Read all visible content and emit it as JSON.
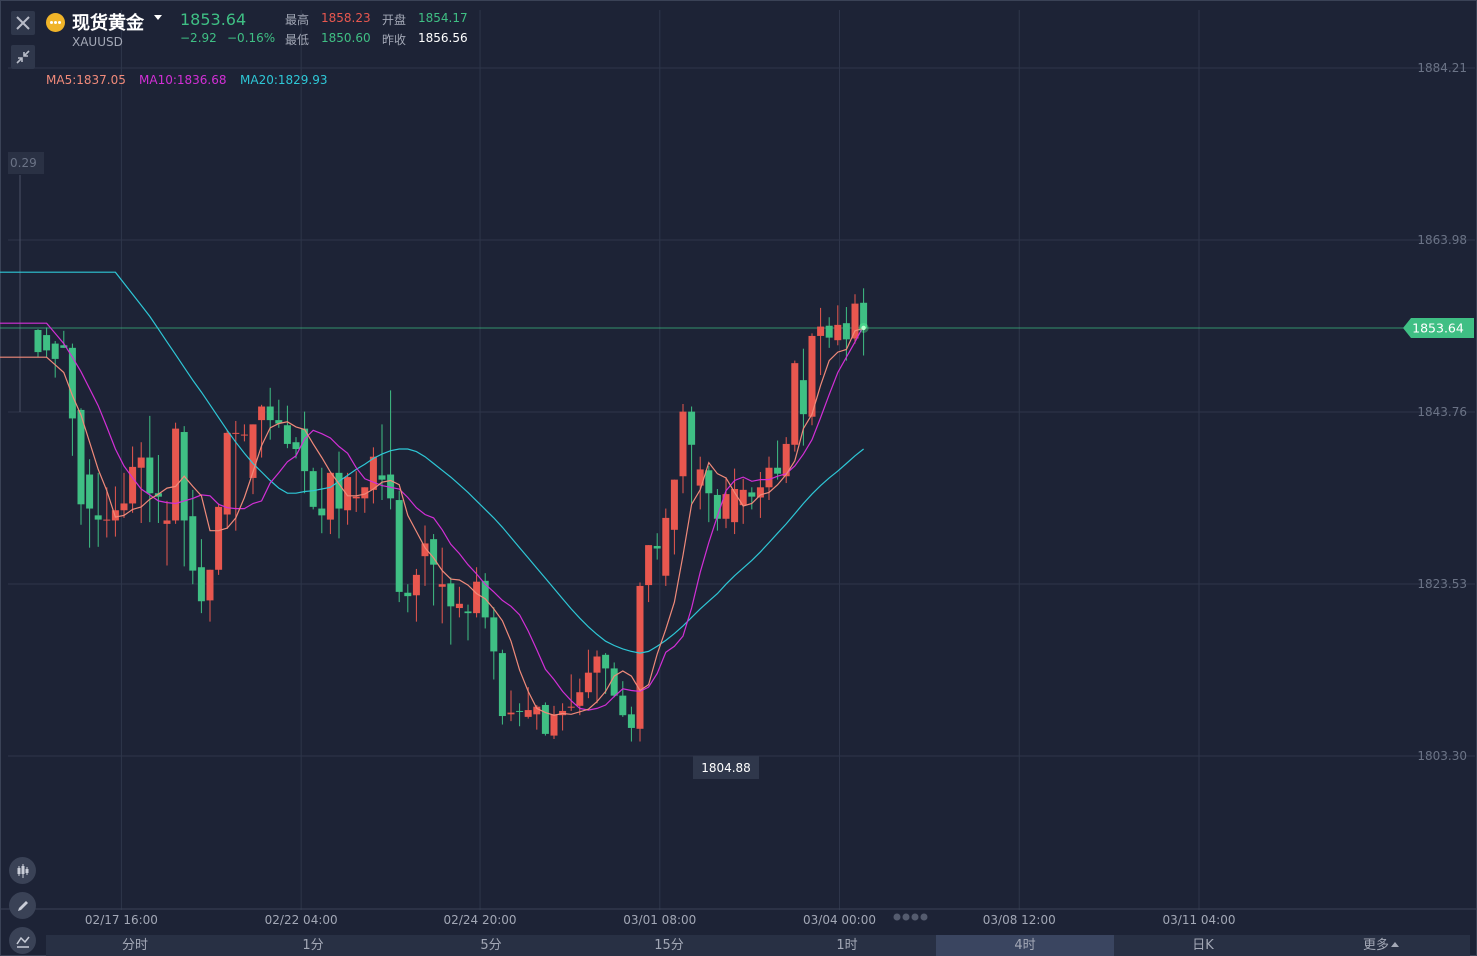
{
  "header": {
    "instrument_name": "现货黄金",
    "symbol": "XAUUSD",
    "last_price": "1853.64",
    "change": "−2.92",
    "change_pct": "−0.16%",
    "high_label": "最高",
    "high_value": "1858.23",
    "low_label": "最低",
    "low_value": "1850.60",
    "open_label": "开盘",
    "open_value": "1854.17",
    "prev_close_label": "昨收",
    "prev_close_value": "1856.56"
  },
  "indicators": {
    "ma5": "MA5:1837.05",
    "ma10": "MA10:1836.68",
    "ma20": "MA20:1829.93"
  },
  "left_fragment_label": "0.29",
  "tabs": [
    "分时",
    "1分",
    "5分",
    "15分",
    "1时",
    "4时",
    "日K",
    "更多"
  ],
  "active_tab": "4时",
  "colors": {
    "background": "#1d2336",
    "up": "#e8574f",
    "down": "#3fbf84",
    "ma5": "#f08a7a",
    "ma10": "#d22fd6",
    "ma20": "#2ec7d6",
    "price_line": "#3fbf84"
  },
  "chart_data": {
    "type": "candlestick",
    "y_ticks": [
      "1884.21",
      "1863.98",
      "1843.76",
      "1823.53",
      "1803.30"
    ],
    "ylim": [
      1796.2,
      1889.8
    ],
    "x_ticks": [
      {
        "label": "02/17 16:00",
        "index": 9.7
      },
      {
        "label": "02/22 04:00",
        "index": 30.6
      },
      {
        "label": "02/24 20:00",
        "index": 51.4
      },
      {
        "label": "03/01 08:00",
        "index": 72.3
      },
      {
        "label": "03/04 00:00",
        "index": 93.2
      },
      {
        "label": "03/08 12:00",
        "index": 114.1
      },
      {
        "label": "03/11 04:00",
        "index": 135.0
      }
    ],
    "current_price": "1853.64",
    "low_annotation": {
      "value": "1804.88",
      "index": 80
    },
    "ohlc": [
      [
        1853.4,
        1853.5,
        1850.2,
        1850.8
      ],
      [
        1852.8,
        1853.7,
        1850.2,
        1851.0
      ],
      [
        1851.8,
        1852.1,
        1847.8,
        1850.0
      ],
      [
        1851.6,
        1853.3,
        1851.3,
        1851.3
      ],
      [
        1851.3,
        1851.8,
        1838.6,
        1843.0
      ],
      [
        1844.0,
        1844.2,
        1830.5,
        1832.9
      ],
      [
        1836.4,
        1838.2,
        1827.8,
        1832.4
      ],
      [
        1831.6,
        1836.6,
        1827.9,
        1831.1
      ],
      [
        1831.0,
        1834.9,
        1829.0,
        1831.1
      ],
      [
        1831.0,
        1835.0,
        1829.1,
        1832.2
      ],
      [
        1832.2,
        1836.6,
        1831.3,
        1833.0
      ],
      [
        1833.0,
        1839.7,
        1831.9,
        1837.3
      ],
      [
        1837.2,
        1840.2,
        1830.7,
        1838.4
      ],
      [
        1838.4,
        1843.3,
        1830.8,
        1834.2
      ],
      [
        1834.2,
        1838.7,
        1830.7,
        1833.8
      ],
      [
        1830.6,
        1833.3,
        1825.7,
        1831.0
      ],
      [
        1831.0,
        1842.5,
        1830.6,
        1841.8
      ],
      [
        1841.4,
        1842.1,
        1825.6,
        1831.0
      ],
      [
        1831.5,
        1834.6,
        1823.5,
        1825.1
      ],
      [
        1825.5,
        1828.8,
        1820.1,
        1821.5
      ],
      [
        1821.6,
        1825.2,
        1819.1,
        1825.2
      ],
      [
        1825.2,
        1833.0,
        1824.6,
        1832.6
      ],
      [
        1831.7,
        1841.6,
        1830.0,
        1841.3
      ],
      [
        1841.2,
        1842.7,
        1829.8,
        1841.3
      ],
      [
        1841.1,
        1842.3,
        1840.3,
        1841.1
      ],
      [
        1836.0,
        1842.3,
        1834.1,
        1842.3
      ],
      [
        1842.8,
        1844.6,
        1838.4,
        1844.4
      ],
      [
        1844.4,
        1846.6,
        1840.5,
        1842.8
      ],
      [
        1842.8,
        1845.2,
        1841.9,
        1842.4
      ],
      [
        1842.2,
        1844.5,
        1839.5,
        1840.0
      ],
      [
        1840.2,
        1840.8,
        1838.3,
        1839.4
      ],
      [
        1841.8,
        1843.8,
        1834.2,
        1836.8
      ],
      [
        1836.8,
        1837.2,
        1832.3,
        1832.6
      ],
      [
        1832.4,
        1837.2,
        1829.5,
        1831.6
      ],
      [
        1831.1,
        1836.7,
        1829.4,
        1836.6
      ],
      [
        1836.6,
        1839.1,
        1828.9,
        1832.4
      ],
      [
        1832.2,
        1836.6,
        1830.5,
        1836.1
      ],
      [
        1833.6,
        1836.8,
        1832.0,
        1833.8
      ],
      [
        1833.6,
        1834.9,
        1831.9,
        1834.9
      ],
      [
        1834.6,
        1839.6,
        1833.0,
        1838.5
      ],
      [
        1836.3,
        1842.3,
        1833.4,
        1835.8
      ],
      [
        1836.4,
        1846.3,
        1832.3,
        1833.6
      ],
      [
        1833.4,
        1834.5,
        1821.4,
        1822.6
      ],
      [
        1822.5,
        1823.5,
        1820.2,
        1822.1
      ],
      [
        1822.2,
        1825.3,
        1819.1,
        1824.6
      ],
      [
        1826.8,
        1830.4,
        1823.3,
        1828.3
      ],
      [
        1828.8,
        1829.4,
        1821.0,
        1825.8
      ],
      [
        1823.2,
        1827.8,
        1818.9,
        1823.5
      ],
      [
        1823.6,
        1824.3,
        1816.4,
        1820.9
      ],
      [
        1820.7,
        1823.2,
        1819.6,
        1821.2
      ],
      [
        1820.3,
        1821.1,
        1816.9,
        1820.1
      ],
      [
        1820.1,
        1825.5,
        1819.6,
        1823.8
      ],
      [
        1823.9,
        1824.8,
        1818.3,
        1819.6
      ],
      [
        1819.6,
        1820.8,
        1812.3,
        1815.6
      ],
      [
        1815.4,
        1815.8,
        1807.0,
        1808.0
      ],
      [
        1808.2,
        1811.0,
        1807.4,
        1808.4
      ],
      [
        1808.6,
        1809.5,
        1806.8,
        1808.5
      ],
      [
        1807.9,
        1811.4,
        1807.7,
        1808.7
      ],
      [
        1808.2,
        1809.3,
        1806.4,
        1809.1
      ],
      [
        1809.3,
        1809.6,
        1805.7,
        1805.9
      ],
      [
        1805.7,
        1809.2,
        1805.3,
        1808.2
      ],
      [
        1808.1,
        1809.5,
        1806.3,
        1808.6
      ],
      [
        1809.0,
        1812.9,
        1808.6,
        1809.1
      ],
      [
        1809.2,
        1812.4,
        1808.1,
        1810.8
      ],
      [
        1810.8,
        1815.8,
        1810.1,
        1813.1
      ],
      [
        1813.1,
        1815.7,
        1809.5,
        1815.0
      ],
      [
        1815.2,
        1815.4,
        1810.6,
        1813.6
      ],
      [
        1813.6,
        1814.3,
        1810.2,
        1810.4
      ],
      [
        1810.4,
        1812.1,
        1807.9,
        1808.1
      ],
      [
        1808.2,
        1809.1,
        1805.0,
        1806.6
      ],
      [
        1806.5,
        1823.7,
        1805.0,
        1823.3
      ],
      [
        1823.4,
        1828.1,
        1821.4,
        1828.1
      ],
      [
        1828.0,
        1829.5,
        1826.4,
        1827.7
      ],
      [
        1824.5,
        1832.4,
        1823.3,
        1831.3
      ],
      [
        1829.9,
        1835.8,
        1827.0,
        1835.8
      ],
      [
        1836.2,
        1844.7,
        1834.2,
        1843.8
      ],
      [
        1843.8,
        1844.4,
        1833.0,
        1839.9
      ],
      [
        1835.1,
        1838.5,
        1832.3,
        1837.0
      ],
      [
        1836.9,
        1837.4,
        1830.8,
        1834.2
      ],
      [
        1834.0,
        1834.7,
        1829.8,
        1831.2
      ],
      [
        1831.2,
        1836.1,
        1830.1,
        1834.1
      ],
      [
        1830.8,
        1837.1,
        1829.4,
        1834.7
      ],
      [
        1832.8,
        1835.9,
        1830.6,
        1834.6
      ],
      [
        1834.3,
        1834.9,
        1832.3,
        1833.8
      ],
      [
        1833.7,
        1836.7,
        1831.3,
        1834.9
      ],
      [
        1834.9,
        1838.5,
        1833.4,
        1837.2
      ],
      [
        1837.2,
        1840.4,
        1835.8,
        1836.5
      ],
      [
        1836.2,
        1840.8,
        1835.4,
        1840.0
      ],
      [
        1839.9,
        1849.8,
        1839.1,
        1849.5
      ],
      [
        1847.5,
        1851.2,
        1839.8,
        1843.5
      ],
      [
        1843.2,
        1853.0,
        1842.2,
        1852.7
      ],
      [
        1852.7,
        1856.0,
        1848.1,
        1853.8
      ],
      [
        1853.9,
        1854.9,
        1851.3,
        1852.5
      ],
      [
        1852.2,
        1856.3,
        1851.6,
        1854.0
      ],
      [
        1854.2,
        1856.1,
        1849.8,
        1852.3
      ],
      [
        1852.4,
        1857.6,
        1851.8,
        1856.5
      ],
      [
        1856.6,
        1858.3,
        1850.4,
        1853.6
      ]
    ],
    "ma5": [
      1850.2,
      1849.3,
      1848.4,
      1845.7,
      1843.4,
      1840.2,
      1837.0,
      1834.5,
      1831.4,
      1831.6,
      1832.3,
      1832.6,
      1833.5,
      1834.1,
      1834.8,
      1835.0,
      1836.2,
      1835.0,
      1833.9,
      1829.8,
      1829.8,
      1830.1,
      1831.3,
      1833.7,
      1836.7,
      1839.8,
      1841.9,
      1842.4,
      1842.6,
      1842.0,
      1841.7,
      1840.0,
      1838.4,
      1836.7,
      1835.3,
      1833.9,
      1833.9,
      1834.1,
      1834.7,
      1835.5,
      1835.7,
      1835.2,
      1831.6,
      1829.7,
      1827.8,
      1826.6,
      1825.1,
      1824.1,
      1824.0,
      1823.4,
      1822.4,
      1821.8,
      1820.6,
      1819.2,
      1816.8,
      1813.4,
      1810.9,
      1808.9,
      1808.4,
      1808.1,
      1808.3,
      1808.2,
      1808.5,
      1808.8,
      1809.7,
      1810.9,
      1812.7,
      1813.3,
      1812.7,
      1811.0,
      1811.7,
      1815.3,
      1818.2,
      1821.4,
      1826.9,
      1832.9,
      1834.6,
      1837.8,
      1836.5,
      1836.0,
      1834.3,
      1832.7,
      1833.0,
      1834.0,
      1834.3,
      1835.2,
      1836.4,
      1838.0,
      1841.8,
      1843.5,
      1846.9,
      1849.8,
      1850.8,
      1851.1,
      1853.3,
      1853.6
    ],
    "ma10": [
      1854.2,
      1853.0,
      1851.8,
      1850.2,
      1848.5,
      1846.5,
      1844.5,
      1842.0,
      1839.4,
      1837.4,
      1836.0,
      1834.7,
      1834.0,
      1833.3,
      1833.1,
      1833.0,
      1833.3,
      1833.6,
      1834.0,
      1833.9,
      1832.9,
      1832.5,
      1832.4,
      1832.4,
      1833.0,
      1833.3,
      1835.4,
      1836.6,
      1837.9,
      1838.6,
      1840.6,
      1841.6,
      1841.2,
      1840.7,
      1839.7,
      1838.9,
      1837.2,
      1835.9,
      1835.5,
      1835.1,
      1834.9,
      1834.7,
      1833.7,
      1832.5,
      1831.7,
      1831.3,
      1829.9,
      1828.2,
      1827.1,
      1825.8,
      1824.7,
      1823.5,
      1822.6,
      1821.6,
      1820.9,
      1819.9,
      1818.0,
      1815.8,
      1813.5,
      1812.3,
      1810.9,
      1809.8,
      1808.9,
      1808.7,
      1808.9,
      1809.3,
      1810.3,
      1811.2,
      1811.0,
      1810.9,
      1811.4,
      1813.0,
      1815.5,
      1816.2,
      1817.4,
      1820.7,
      1824.9,
      1828.4,
      1831.5,
      1834.5,
      1835.7,
      1836.1,
      1835.6,
      1835.8,
      1835.8,
      1836.2,
      1836.5,
      1837.4,
      1838.8,
      1840.5,
      1843.1,
      1845.8,
      1848.4,
      1850.2,
      1852.0,
      1853.9
    ],
    "ma20": [
      1860.2,
      1858.9,
      1857.6,
      1856.3,
      1855.0,
      1853.5,
      1852.0,
      1850.5,
      1849.0,
      1847.5,
      1846.1,
      1844.6,
      1843.1,
      1841.6,
      1840.2,
      1838.9,
      1837.7,
      1836.7,
      1835.7,
      1834.8,
      1834.2,
      1834.2,
      1834.4,
      1834.5,
      1834.7,
      1834.9,
      1835.6,
      1836.3,
      1837.0,
      1837.6,
      1838.3,
      1838.8,
      1839.2,
      1839.4,
      1839.4,
      1839.1,
      1838.5,
      1837.7,
      1836.9,
      1836.1,
      1835.2,
      1834.3,
      1833.3,
      1832.3,
      1831.3,
      1830.2,
      1829.0,
      1827.8,
      1826.6,
      1825.4,
      1824.2,
      1823.0,
      1821.8,
      1820.6,
      1819.5,
      1818.5,
      1817.6,
      1816.8,
      1816.3,
      1815.9,
      1815.6,
      1815.4,
      1815.6,
      1816.2,
      1816.9,
      1817.7,
      1818.6,
      1819.6,
      1820.6,
      1821.5,
      1822.4,
      1823.5,
      1824.5,
      1825.4,
      1826.3,
      1827.3,
      1828.4,
      1829.5,
      1830.6,
      1831.8,
      1833.0,
      1834.1,
      1835.1,
      1836.0,
      1836.8,
      1837.7,
      1838.6,
      1839.4
    ]
  }
}
